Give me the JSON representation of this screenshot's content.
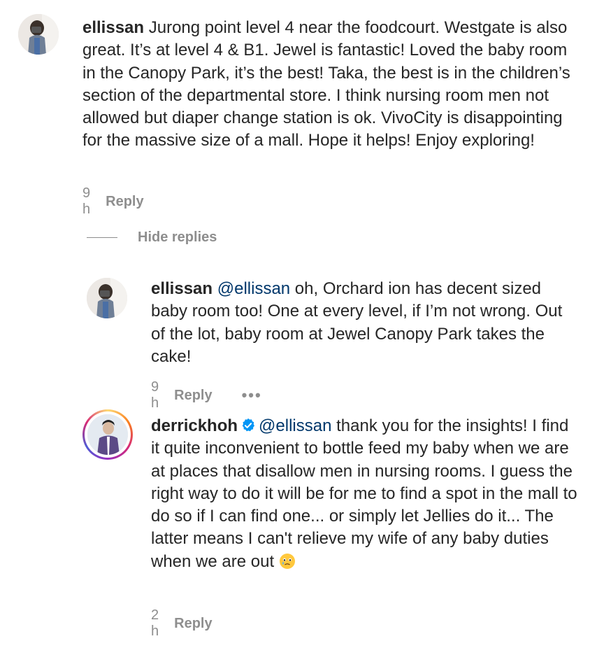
{
  "comments": [
    {
      "username": "ellissan",
      "body": " Jurong point level 4 near the foodcourt. Westgate is also great. It’s at level 4 & B1. Jewel is fantastic! Loved the baby room in the Canopy Park, it’s the best! Taka, the best is in the children’s section of the departmental store. I think nursing room men not allowed but diaper change station is ok. VivoCity is disappointing for the massive size of a mall. Hope it helps! Enjoy exploring!",
      "time": "9 h",
      "reply_label": "Reply"
    }
  ],
  "hide_replies_label": "Hide replies",
  "replies": [
    {
      "username": "ellissan",
      "mention": "@ellissan",
      "body": " oh, Orchard ion has decent sized baby room too! One at every level, if I’m not wrong. Out of the lot, baby room at Jewel Canopy Park takes the cake!",
      "time": "9 h",
      "reply_label": "Reply",
      "more_label": "•••"
    },
    {
      "username": "derrickhoh",
      "mention": "@ellissan",
      "body": " thank you for the insights! I find it quite inconvenient to bottle feed my baby when we are at places that disallow men in nursing rooms. I guess the right way to do it will be for me to find a spot in the mall to do so if I can find one... or simply let Jellies do it... The latter means I can't relieve my wife of any baby duties when we are out ",
      "emoji": "face-holding-back-tears-icon",
      "time": "2 h",
      "reply_label": "Reply"
    }
  ],
  "colors": {
    "text": "#262626",
    "secondary": "#8e8e8e",
    "mention": "#00376b",
    "verified": "#0095f6"
  }
}
